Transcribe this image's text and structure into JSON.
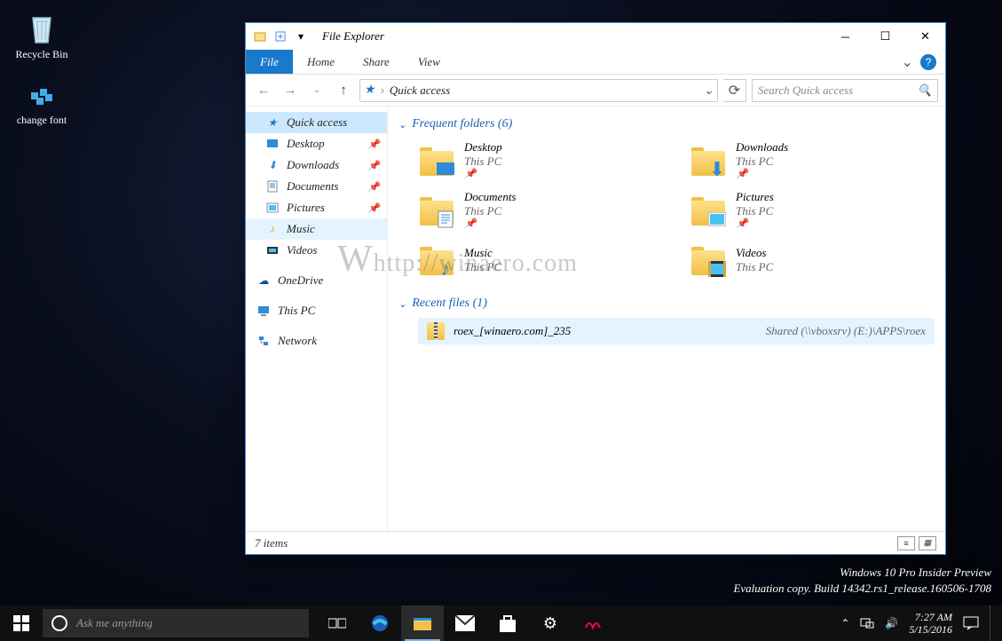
{
  "desktop": {
    "icons": [
      {
        "name": "Recycle Bin",
        "glyph": "recycle"
      },
      {
        "name": "change font",
        "glyph": "regcube"
      }
    ]
  },
  "watermark": {
    "line1": "Windows 10 Pro Insider Preview",
    "line2": "Evaluation copy. Build 14342.rs1_release.160506-1708"
  },
  "page_watermark": "http://winaero.com",
  "window": {
    "title": "File Explorer",
    "tabs": {
      "file": "File",
      "home": "Home",
      "share": "Share",
      "view": "View"
    },
    "nav": {
      "breadcrumb": "Quick access",
      "search_placeholder": "Search Quick access"
    },
    "sidebar": {
      "quick_access": "Quick access",
      "items": [
        {
          "label": "Desktop",
          "icon": "desktop",
          "pinned": true
        },
        {
          "label": "Downloads",
          "icon": "downloads",
          "pinned": true
        },
        {
          "label": "Documents",
          "icon": "documents",
          "pinned": true
        },
        {
          "label": "Pictures",
          "icon": "pictures",
          "pinned": true
        },
        {
          "label": "Music",
          "icon": "music",
          "pinned": false,
          "hover": true
        },
        {
          "label": "Videos",
          "icon": "videos",
          "pinned": false
        }
      ],
      "onedrive": "OneDrive",
      "thispc": "This PC",
      "network": "Network"
    },
    "content": {
      "freq_header": "Frequent folders (6)",
      "folders": [
        {
          "name": "Desktop",
          "sub": "This PC",
          "overlay": "desktop"
        },
        {
          "name": "Downloads",
          "sub": "This PC",
          "overlay": "downloads"
        },
        {
          "name": "Documents",
          "sub": "This PC",
          "overlay": "documents"
        },
        {
          "name": "Pictures",
          "sub": "This PC",
          "overlay": "pictures"
        },
        {
          "name": "Music",
          "sub": "This PC",
          "overlay": "music"
        },
        {
          "name": "Videos",
          "sub": "This PC",
          "overlay": "videos"
        }
      ],
      "recent_header": "Recent files (1)",
      "recent": [
        {
          "name": "roex_[winaero.com]_235",
          "path": "Shared (\\\\vboxsrv) (E:)\\APPS\\roex"
        }
      ]
    },
    "status": "7 items"
  },
  "taskbar": {
    "search_placeholder": "Ask me anything",
    "clock": {
      "time": "7:27 AM",
      "date": "5/15/2016"
    }
  }
}
